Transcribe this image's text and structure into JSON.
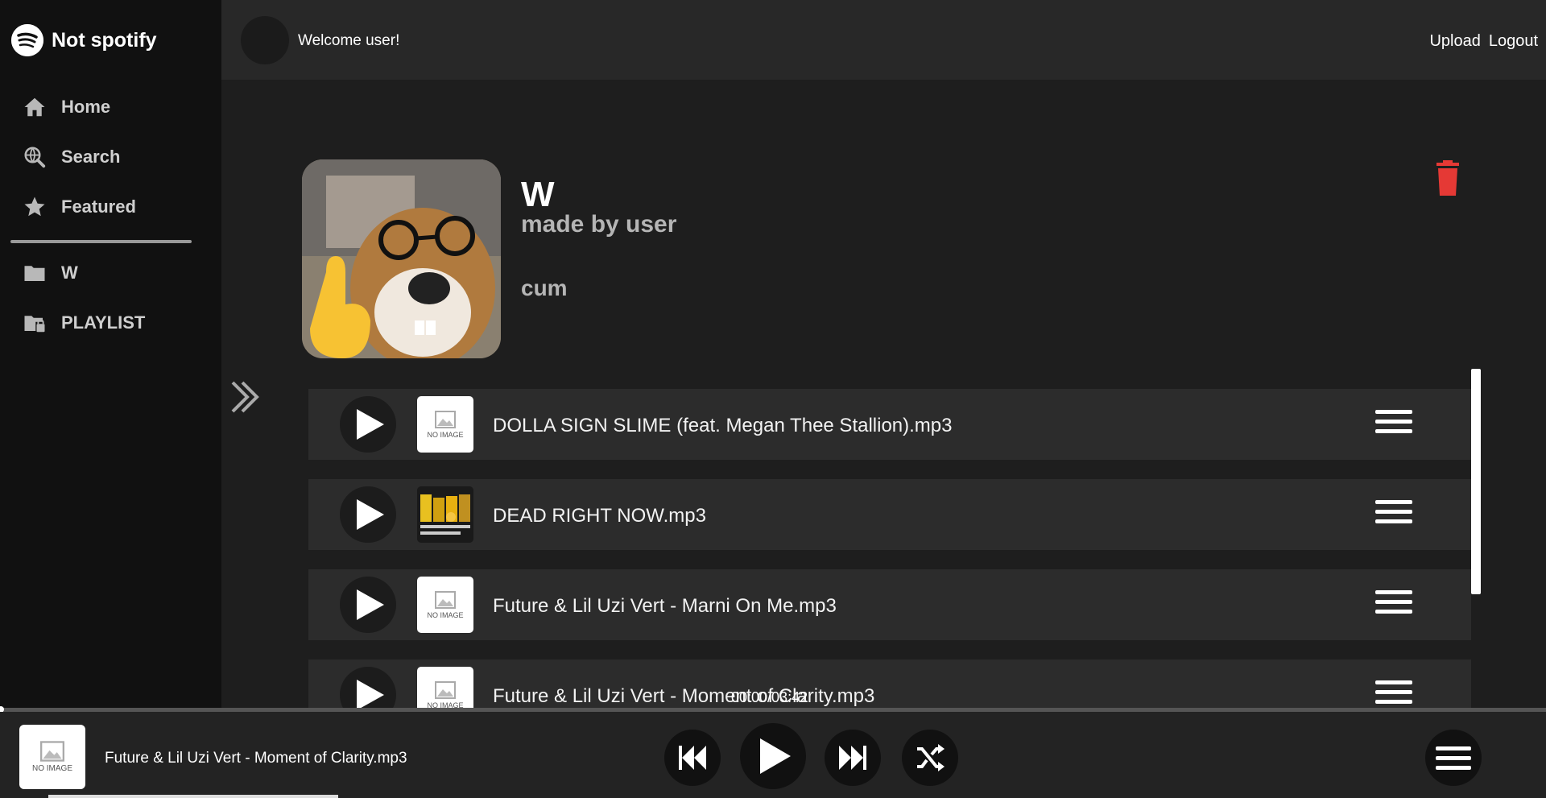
{
  "app": {
    "title": "Not spotify"
  },
  "sidebar": {
    "items": [
      {
        "label": "Home",
        "icon": "home-icon"
      },
      {
        "label": "Search",
        "icon": "globe-search-icon"
      },
      {
        "label": "Featured",
        "icon": "star-icon"
      }
    ],
    "playlists": [
      {
        "label": "W",
        "icon": "folder-icon"
      },
      {
        "label": "PLAYLIST",
        "icon": "folder-lock-icon"
      }
    ]
  },
  "header": {
    "welcome": "Welcome user!",
    "upload_label": "Upload",
    "logout_label": "Logout"
  },
  "playlist": {
    "title": "W",
    "author": "made by user",
    "description": "cum"
  },
  "tracks": [
    {
      "title": "DOLLA SIGN SLIME (feat. Megan Thee Stallion).mp3",
      "thumb": "NO IMAGE"
    },
    {
      "title": "DEAD RIGHT NOW.mp3",
      "thumb": ""
    },
    {
      "title": "Future & Lil Uzi Vert - Marni On Me.mp3",
      "thumb": "NO IMAGE"
    },
    {
      "title": "Future & Lil Uzi Vert - Moment of Clarity.mp3",
      "thumb": "NO IMAGE"
    }
  ],
  "player": {
    "now_playing": "Future & Lil Uzi Vert - Moment of Clarity.mp3",
    "thumb_label": "NO IMAGE",
    "time": "00:00/03:42",
    "progress": 0
  },
  "colors": {
    "accent_delete": "#e53935",
    "background": "#1e1e1e",
    "sidebar": "#111111"
  }
}
